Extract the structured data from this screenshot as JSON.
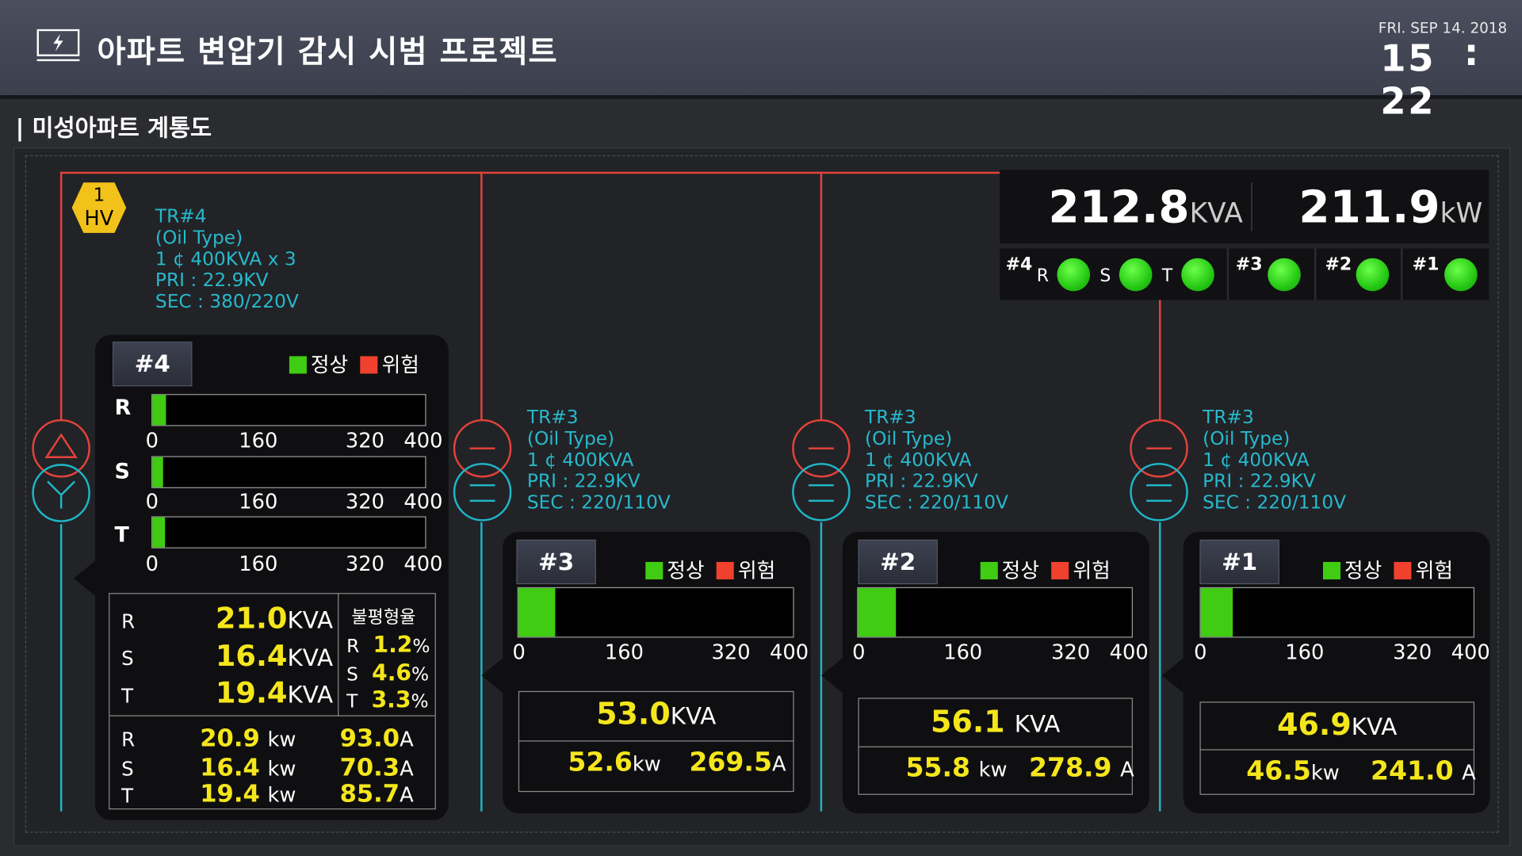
{
  "header": {
    "title": "아파트 변압기 감시 시범 프로젝트",
    "date": "FRI. SEP  14. 2018",
    "hour": "15",
    "colon": ":",
    "minute": "22"
  },
  "section_title": "| 미성아파트 계통도",
  "summary": {
    "kva_value": "212.8",
    "kva_unit": "KVA",
    "kw_value": "211.9",
    "kw_unit": "kW",
    "status": {
      "t4": "#4",
      "r": "R",
      "s": "S",
      "t": "T",
      "t3": "#3",
      "t2": "#2",
      "t1": "#1"
    }
  },
  "hv_badge": {
    "line1": "1",
    "line2": "HV"
  },
  "legend": {
    "normal": "정상",
    "danger": "위험"
  },
  "colors": {
    "normal": "#3fcc12",
    "danger": "#f0402e",
    "value": "#f5e61c",
    "wire_primary": "#e5433a",
    "wire_secondary": "#1fb6c8"
  },
  "scale": {
    "s0": "0",
    "s1": "160",
    "s2": "320",
    "s3": "400"
  },
  "tr4": {
    "spec": "TR#4\n(Oil Type)\n1 ¢ 400KVA x 3\nPRI : 22.9KV\nSEC : 380/220V",
    "tab": "#4",
    "r": "R",
    "s": "S",
    "t": "T",
    "level_r": 0.05,
    "level_s": 0.04,
    "level_t": 0.048,
    "kva_r": "21.0",
    "kva_s": "16.4",
    "kva_t": "19.4",
    "kva_unit": "KVA",
    "unbalance_label": "불평형율",
    "ub_r": "1.2",
    "ub_s": "4.6",
    "ub_t": "3.3",
    "pct": "%",
    "kw_r": "20.9",
    "kw_s": "16.4",
    "kw_t": "19.4",
    "kw_unit": "kw",
    "a_r": "93.0",
    "a_s": "70.3",
    "a_t": "85.7",
    "a_unit": "A"
  },
  "tr3": {
    "spec": "TR#3\n(Oil Type)\n1 ¢ 400KVA\nPRI : 22.9KV\nSEC : 220/110V",
    "tab": "#3",
    "level": 0.133,
    "kva": "53.0",
    "kva_unit": "KVA",
    "kw": "52.6",
    "kw_unit": "kw",
    "a": "269.5",
    "a_unit": "A"
  },
  "tr2": {
    "spec": "TR#3\n(Oil Type)\n1 ¢ 400KVA\nPRI : 22.9KV\nSEC : 220/110V",
    "tab": "#2",
    "level": 0.14,
    "kva": "56.1",
    "kva_unit": "KVA",
    "kw": "55.8",
    "kw_unit": "kw",
    "a": "278.9",
    "a_unit": "A"
  },
  "tr1": {
    "spec": "TR#3\n(Oil Type)\n1 ¢ 400KVA\nPRI : 22.9KV\nSEC : 220/110V",
    "tab": "#1",
    "level": 0.117,
    "kva": "46.9",
    "kva_unit": "KVA",
    "kw": "46.5",
    "kw_unit": "kw",
    "a": "241.0",
    "a_unit": "A"
  }
}
